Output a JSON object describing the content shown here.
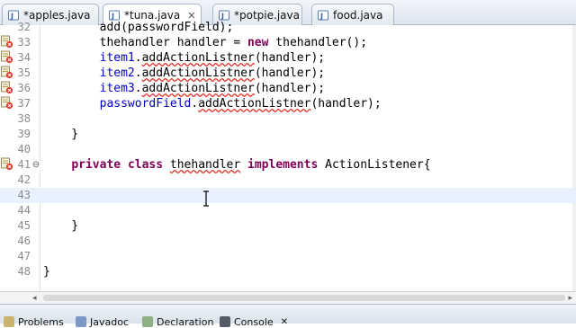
{
  "tabs": [
    {
      "label": "*apples.java",
      "active": false
    },
    {
      "label": "*tuna.java",
      "active": true,
      "close": "✕"
    },
    {
      "label": "*potpie.java",
      "active": false
    },
    {
      "label": "food.java",
      "active": false
    }
  ],
  "lines": [
    {
      "num": "33",
      "marker": "error",
      "parts": [
        {
          "t": "        thehandler handler = "
        },
        {
          "t": "new",
          "k": "kw"
        },
        {
          "t": " thehandler();"
        }
      ]
    },
    {
      "num": "34",
      "marker": "error",
      "parts": [
        {
          "t": "        "
        },
        {
          "t": "item1",
          "k": "fld"
        },
        {
          "t": "."
        },
        {
          "t": "addActionListner",
          "k": "err"
        },
        {
          "t": "(handler);"
        }
      ]
    },
    {
      "num": "35",
      "marker": "error",
      "parts": [
        {
          "t": "        "
        },
        {
          "t": "item2",
          "k": "fld"
        },
        {
          "t": "."
        },
        {
          "t": "addActionListner",
          "k": "err"
        },
        {
          "t": "(handler);"
        }
      ]
    },
    {
      "num": "36",
      "marker": "error",
      "parts": [
        {
          "t": "        "
        },
        {
          "t": "item3",
          "k": "fld"
        },
        {
          "t": "."
        },
        {
          "t": "addActionListner",
          "k": "err"
        },
        {
          "t": "(handler);"
        }
      ]
    },
    {
      "num": "37",
      "marker": "error",
      "parts": [
        {
          "t": "        "
        },
        {
          "t": "passwordField",
          "k": "fld"
        },
        {
          "t": "."
        },
        {
          "t": "addActionListner",
          "k": "err"
        },
        {
          "t": "(handler);"
        }
      ]
    },
    {
      "num": "38",
      "marker": "",
      "parts": []
    },
    {
      "num": "39",
      "marker": "",
      "parts": [
        {
          "t": "    }"
        }
      ]
    },
    {
      "num": "40",
      "marker": "",
      "parts": []
    },
    {
      "num": "41",
      "marker": "error",
      "fold": "⊖",
      "parts": [
        {
          "t": "    "
        },
        {
          "t": "private",
          "k": "kw"
        },
        {
          "t": " "
        },
        {
          "t": "class",
          "k": "kw"
        },
        {
          "t": " "
        },
        {
          "t": "thehandler",
          "k": "err"
        },
        {
          "t": " "
        },
        {
          "t": "implements",
          "k": "kw"
        },
        {
          "t": " ActionListener{"
        }
      ]
    },
    {
      "num": "42",
      "marker": "",
      "parts": []
    },
    {
      "num": "43",
      "marker": "",
      "current": true,
      "parts": []
    },
    {
      "num": "44",
      "marker": "",
      "parts": []
    },
    {
      "num": "45",
      "marker": "",
      "parts": [
        {
          "t": "    }"
        }
      ]
    },
    {
      "num": "46",
      "marker": "",
      "parts": []
    },
    {
      "num": "47",
      "marker": "",
      "parts": []
    },
    {
      "num": "48",
      "marker": "",
      "parts": [
        {
          "t": "}"
        }
      ]
    }
  ],
  "partial_top": {
    "num": "32",
    "text": "        add(passwordField);"
  },
  "bottom_tabs": [
    "Problems",
    "Javadoc",
    "Declaration",
    "Console"
  ],
  "bottom_close": "✕",
  "colors": {
    "keyword": "#7f0055",
    "field": "#0000c0",
    "error": "#e0342a",
    "current_line": "#e8f2fe"
  }
}
